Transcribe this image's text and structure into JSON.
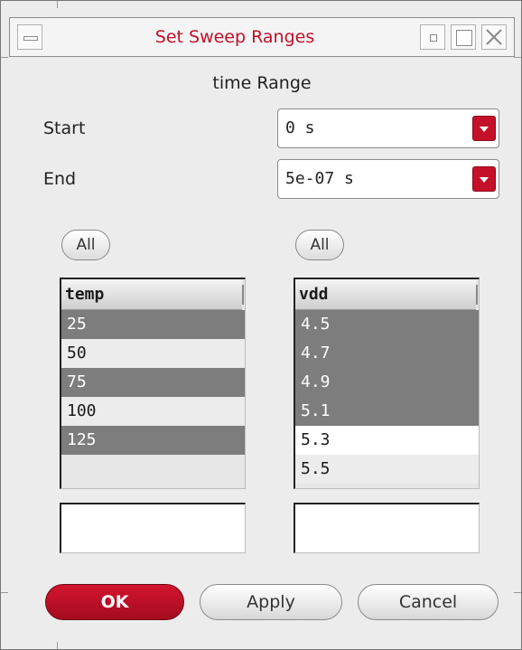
{
  "window": {
    "title": "Set Sweep Ranges"
  },
  "range": {
    "title": "time Range",
    "start_label": "Start",
    "start_value": "0 s",
    "end_label": "End",
    "end_value": "5e-07 s"
  },
  "left_panel": {
    "all_label": "All",
    "header": "temp",
    "rows": [
      {
        "value": "25",
        "selected": true
      },
      {
        "value": "50",
        "selected": false
      },
      {
        "value": "75",
        "selected": true
      },
      {
        "value": "100",
        "selected": false
      },
      {
        "value": "125",
        "selected": true
      }
    ],
    "entry_value": ""
  },
  "right_panel": {
    "all_label": "All",
    "header": "vdd",
    "rows": [
      {
        "value": "4.5",
        "selected": true
      },
      {
        "value": "4.7",
        "selected": true
      },
      {
        "value": "4.9",
        "selected": true
      },
      {
        "value": "5.1",
        "selected": true
      },
      {
        "value": "5.3",
        "selected": false
      },
      {
        "value": "5.5",
        "selected": false
      }
    ],
    "entry_value": ""
  },
  "buttons": {
    "ok": "OK",
    "apply": "Apply",
    "cancel": "Cancel"
  },
  "colors": {
    "accent": "#c5102a",
    "title_text": "#c0102a",
    "selected_row": "#7d7d7d"
  },
  "icons": [
    "window-menu-icon",
    "minimize-icon",
    "maximize-icon",
    "close-icon",
    "dropdown-arrow-icon"
  ]
}
